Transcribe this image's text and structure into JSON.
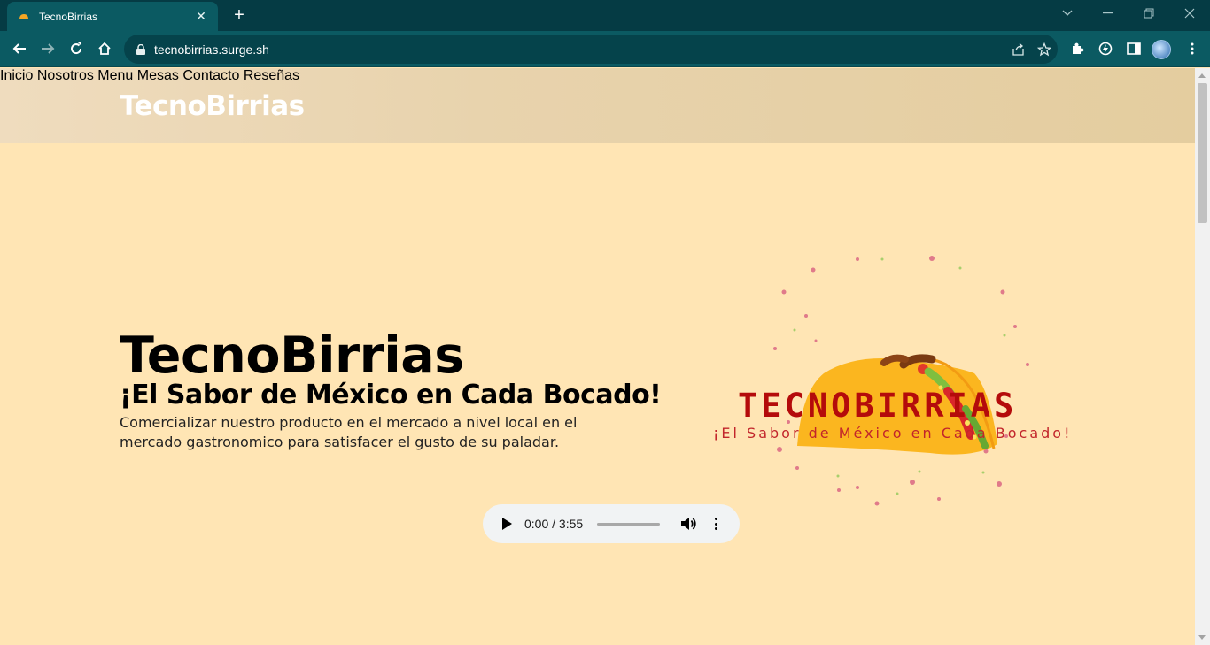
{
  "browser": {
    "tab_title": "TecnoBirrias",
    "url": "tecnobirrias.surge.sh",
    "new_tab_symbol": "+",
    "close_symbol": "✕"
  },
  "header": {
    "brand": "TecnoBirrias",
    "nav": [
      {
        "label": "Inicio"
      },
      {
        "label": "Nosotros"
      },
      {
        "label": "Menu"
      },
      {
        "label": "Mesas"
      },
      {
        "label": "Contacto"
      },
      {
        "label": "Reseñas"
      }
    ]
  },
  "hero": {
    "title": "TecnoBirrias",
    "subtitle": "¡El Sabor de México en Cada Bocado!",
    "description": "Comercializar nuestro producto en el mercado a nivel local en el mercado gastronomico para satisfacer el gusto de su paladar."
  },
  "logo": {
    "wordmark": "TECNOBIRRIAS",
    "tagline": "¡El Sabor de México en Cada Bocado!"
  },
  "audio": {
    "time": "0:00 / 3:55",
    "progress_fraction": 0
  },
  "colors": {
    "page_bg": "#ffe5b4",
    "browser_frame": "#053b44",
    "toolbar": "#0b5a62",
    "logo_red": "#b40b0b",
    "taco_yellow": "#fbb61f"
  }
}
